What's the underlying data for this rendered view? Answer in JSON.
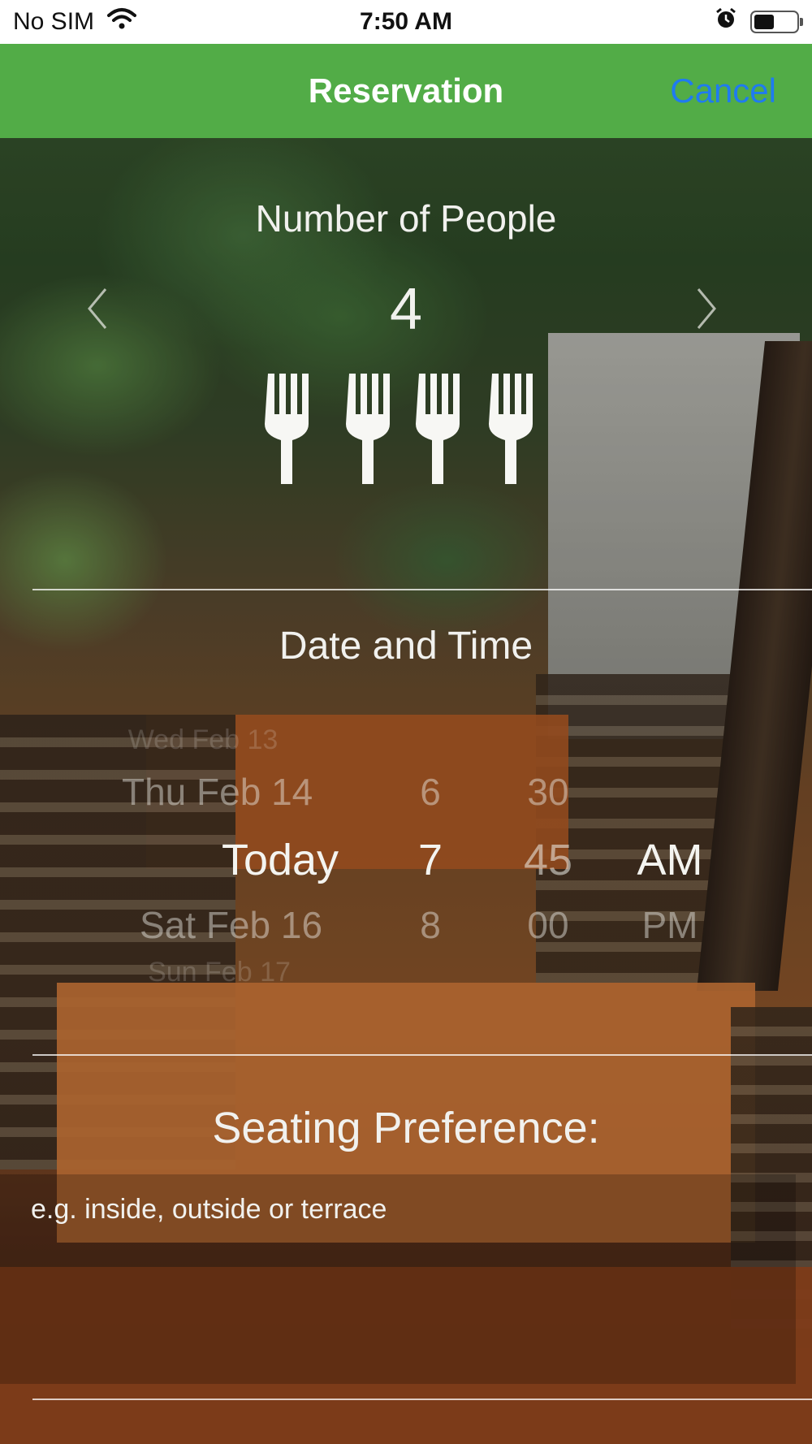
{
  "status_bar": {
    "carrier": "No SIM",
    "time": "7:50 AM",
    "icons": [
      "wifi-icon",
      "alarm-icon",
      "battery-icon"
    ]
  },
  "nav": {
    "title": "Reservation",
    "cancel_label": "Cancel"
  },
  "colors": {
    "nav_green": "#52ac47",
    "cancel_blue": "#1f7bf0",
    "text_light": "#f1f1ee"
  },
  "people": {
    "title": "Number of People",
    "count": "4",
    "icon": "fork-icon",
    "icon_count": 4
  },
  "date_time": {
    "title": "Date and Time",
    "columns": {
      "day": {
        "far_above": "Wed Feb 13",
        "above": "Thu Feb 14",
        "selected": "Today",
        "below": "Sat Feb 16",
        "far_below": "Sun Feb 17"
      },
      "hour": {
        "above": "6",
        "selected": "7",
        "below": "8"
      },
      "minute": {
        "above": "30",
        "selected": "45",
        "below": "00"
      },
      "ampm": {
        "selected": "AM",
        "below": "PM"
      }
    }
  },
  "seating": {
    "title": "Seating Preference:",
    "placeholder": "e.g. inside, outside or terrace"
  }
}
